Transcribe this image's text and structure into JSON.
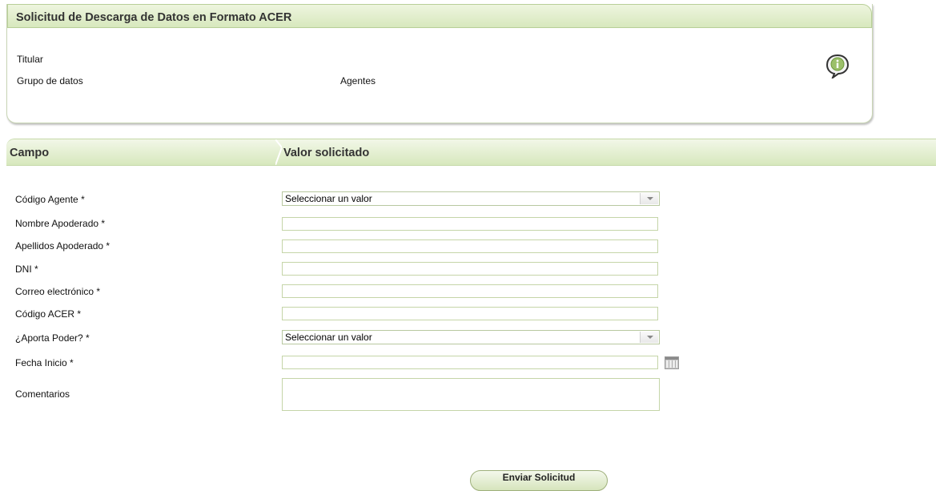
{
  "panel": {
    "title": "Solicitud de Descarga de Datos en Formato ACER",
    "titular_label": "Titular",
    "grupo_label": "Grupo de datos",
    "grupo_value": "Agentes",
    "info_icon": "info-speech-bubble-icon"
  },
  "grid": {
    "col_campo": "Campo",
    "col_valor": "Valor solicitado"
  },
  "fields": {
    "codigo_agente": {
      "label": "Código Agente *",
      "value": "Seleccionar un valor"
    },
    "nombre_apoderado": {
      "label": "Nombre Apoderado *",
      "value": ""
    },
    "apellidos_apoderado": {
      "label": "Apellidos Apoderado *",
      "value": ""
    },
    "dni": {
      "label": "DNI *",
      "value": ""
    },
    "correo": {
      "label": "Correo electrónico *",
      "value": ""
    },
    "codigo_acer": {
      "label": "Código ACER *",
      "value": ""
    },
    "aporta_poder": {
      "label": "¿Aporta Poder? *",
      "value": "Seleccionar un valor"
    },
    "fecha_inicio": {
      "label": "Fecha Inicio *",
      "value": "",
      "icon": "calendar-icon"
    },
    "comentarios": {
      "label": "Comentarios",
      "value": ""
    }
  },
  "actions": {
    "submit_label": "Enviar Solicitud"
  },
  "colors": {
    "header_green_light": "#eef5df",
    "header_green_dark": "#d7e8bd",
    "border_green": "#c5d5a8"
  }
}
